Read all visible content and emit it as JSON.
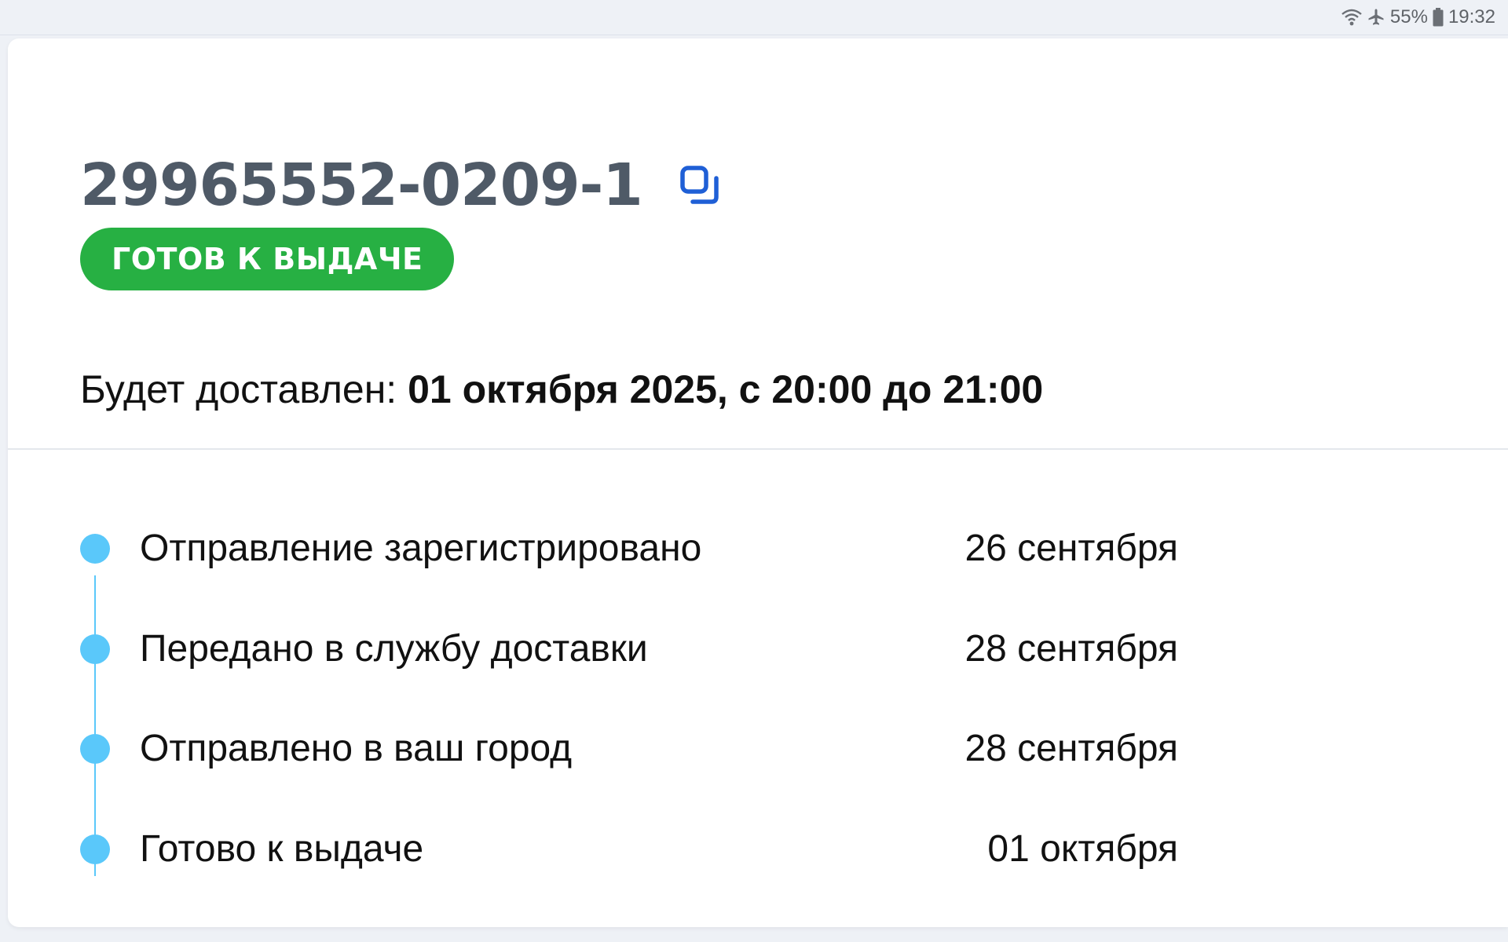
{
  "status_bar": {
    "wifi_icon": "wifi-icon",
    "airplane_icon": "airplane-icon",
    "battery_percent": "55%",
    "battery_icon": "battery-icon",
    "time": "19:32"
  },
  "order": {
    "number": "29965552-0209-1",
    "copy_icon": "copy-icon",
    "status": "ГОТОВ К ВЫДАЧЕ",
    "status_color": "#27b043",
    "delivery_label": "Будет доставлен: ",
    "delivery_value": "01 октября 2025, с 20:00 до 21:00"
  },
  "timeline": {
    "accent_color": "#5ac8fa",
    "events": [
      {
        "label": "Отправление зарегистрировано",
        "date": "26 сентября"
      },
      {
        "label": "Передано в службу доставки",
        "date": "28 сентября"
      },
      {
        "label": "Отправлено в ваш город",
        "date": "28 сентября"
      },
      {
        "label": "Готово к выдаче",
        "date": "01 октября"
      }
    ]
  }
}
